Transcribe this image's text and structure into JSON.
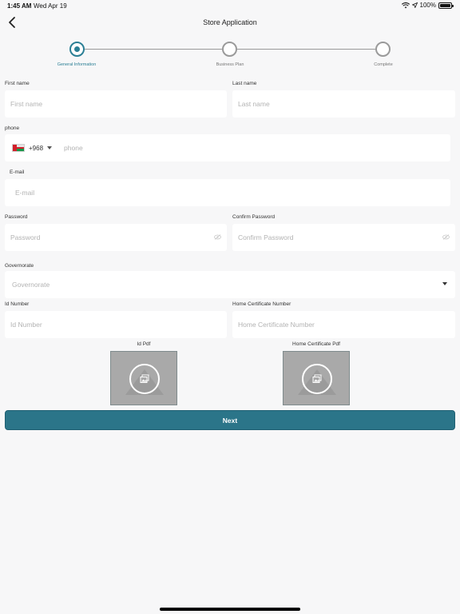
{
  "status_bar": {
    "time": "1:45 AM",
    "date": "Wed Apr 19",
    "battery": "100%",
    "battery_level": 1.0
  },
  "header": {
    "title": "Store Application"
  },
  "stepper": {
    "steps": [
      {
        "label": "General Information",
        "state": "active"
      },
      {
        "label": "Business Plan",
        "state": "pending"
      },
      {
        "label": "Complete",
        "state": "pending"
      }
    ]
  },
  "form": {
    "first_name": {
      "label": "First name",
      "placeholder": "First name"
    },
    "last_name": {
      "label": "Last name",
      "placeholder": "Last name"
    },
    "phone": {
      "label": "phone",
      "placeholder": "phone",
      "country_code": "+968"
    },
    "email": {
      "label": "E-mail",
      "placeholder": "E-mail"
    },
    "password": {
      "label": "Password",
      "placeholder": "Password"
    },
    "confirm_password": {
      "label": "Confirm Password",
      "placeholder": "Confirm Password"
    },
    "governorate": {
      "label": "Governorate",
      "placeholder": "Governorate"
    },
    "id_number": {
      "label": "Id Number",
      "placeholder": "Id Number"
    },
    "home_certificate_number": {
      "label": "Home Certificate Number",
      "placeholder": "Home Certificate Number"
    },
    "id_pdf": {
      "label": "Id Pdf"
    },
    "home_certificate_pdf": {
      "label": "Home Certificate Pdf"
    },
    "next_label": "Next"
  },
  "colors": {
    "accent": "#2b7f95",
    "button": "#2b7589",
    "background": "#f7f7f8"
  },
  "icons": [
    "back-chevron-icon",
    "wifi-icon",
    "location-arrow-icon",
    "battery-icon",
    "eye-off-icon",
    "chevron-down-icon",
    "image-upload-icon"
  ]
}
